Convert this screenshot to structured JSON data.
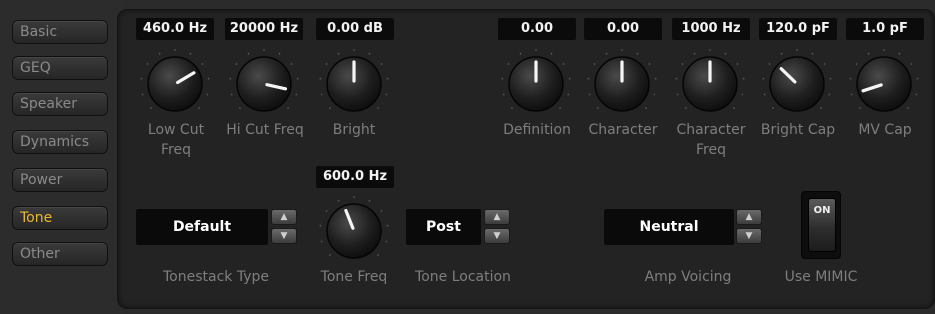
{
  "sidebar": {
    "items": [
      {
        "label": "Basic"
      },
      {
        "label": "GEQ"
      },
      {
        "label": "Speaker"
      },
      {
        "label": "Dynamics"
      },
      {
        "label": "Power"
      },
      {
        "label": "Tone"
      },
      {
        "label": "Other"
      }
    ],
    "active": "Tone"
  },
  "knobs": {
    "low_cut": {
      "value": "460.0 Hz",
      "label_line1": "Low Cut",
      "label_line2": "Freq",
      "level": 0.72
    },
    "hi_cut": {
      "value": "20000 Hz",
      "label": "Hi Cut Freq",
      "level": 0.88
    },
    "bright": {
      "value": "0.00 dB",
      "label": "Bright",
      "level": 0.5
    },
    "definition": {
      "value": "0.00",
      "label": "Definition",
      "level": 0.5
    },
    "character": {
      "value": "0.00",
      "label": "Character",
      "level": 0.5
    },
    "character_freq": {
      "value": "1000 Hz",
      "label_line1": "Character",
      "label_line2": "Freq",
      "level": 0.5
    },
    "bright_cap": {
      "value": "120.0 pF",
      "label": "Bright Cap",
      "level": 0.33
    },
    "mv_cap": {
      "value": "1.0 pF",
      "label": "MV Cap",
      "level": 0.1
    },
    "tone_freq": {
      "value": "600.0 Hz",
      "label": "Tone Freq",
      "level": 0.42
    }
  },
  "tonestack": {
    "value": "Default",
    "label": "Tonestack Type"
  },
  "tone_location": {
    "value": "Post",
    "label": "Tone Location"
  },
  "amp_voicing": {
    "value": "Neutral",
    "label": "Amp Voicing"
  },
  "mimic": {
    "state": "ON",
    "label": "Use MIMIC"
  },
  "spin_icons": {
    "up": "▲",
    "down": "▼"
  },
  "colors": {
    "active_tab": "#e8b931",
    "label": "#7e7e7e",
    "background": "#2b2b2b"
  }
}
